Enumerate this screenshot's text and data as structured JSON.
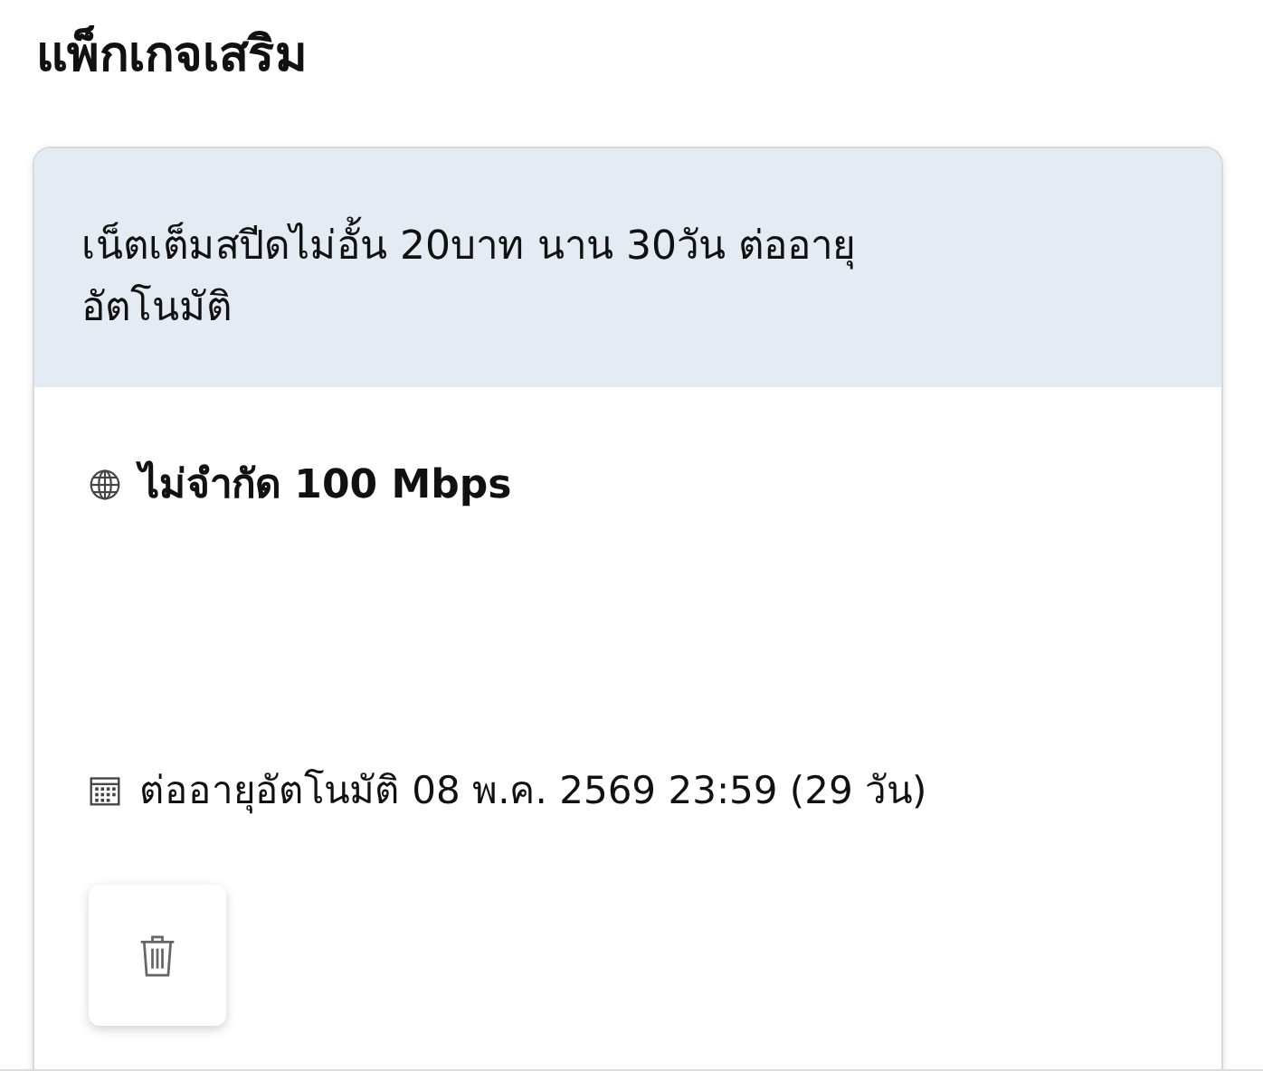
{
  "section_title": "แพ็กเกจเสริม",
  "package": {
    "name": "เน็ตเต็มสปีดไม่อั้น 20บาท นาน 30วัน ต่ออายุอัตโนมัติ",
    "speed": "ไม่จำกัด 100 Mbps",
    "renewal": "ต่ออายุอัตโนมัติ 08 พ.ค. 2569 23:59 (29 วัน)"
  }
}
